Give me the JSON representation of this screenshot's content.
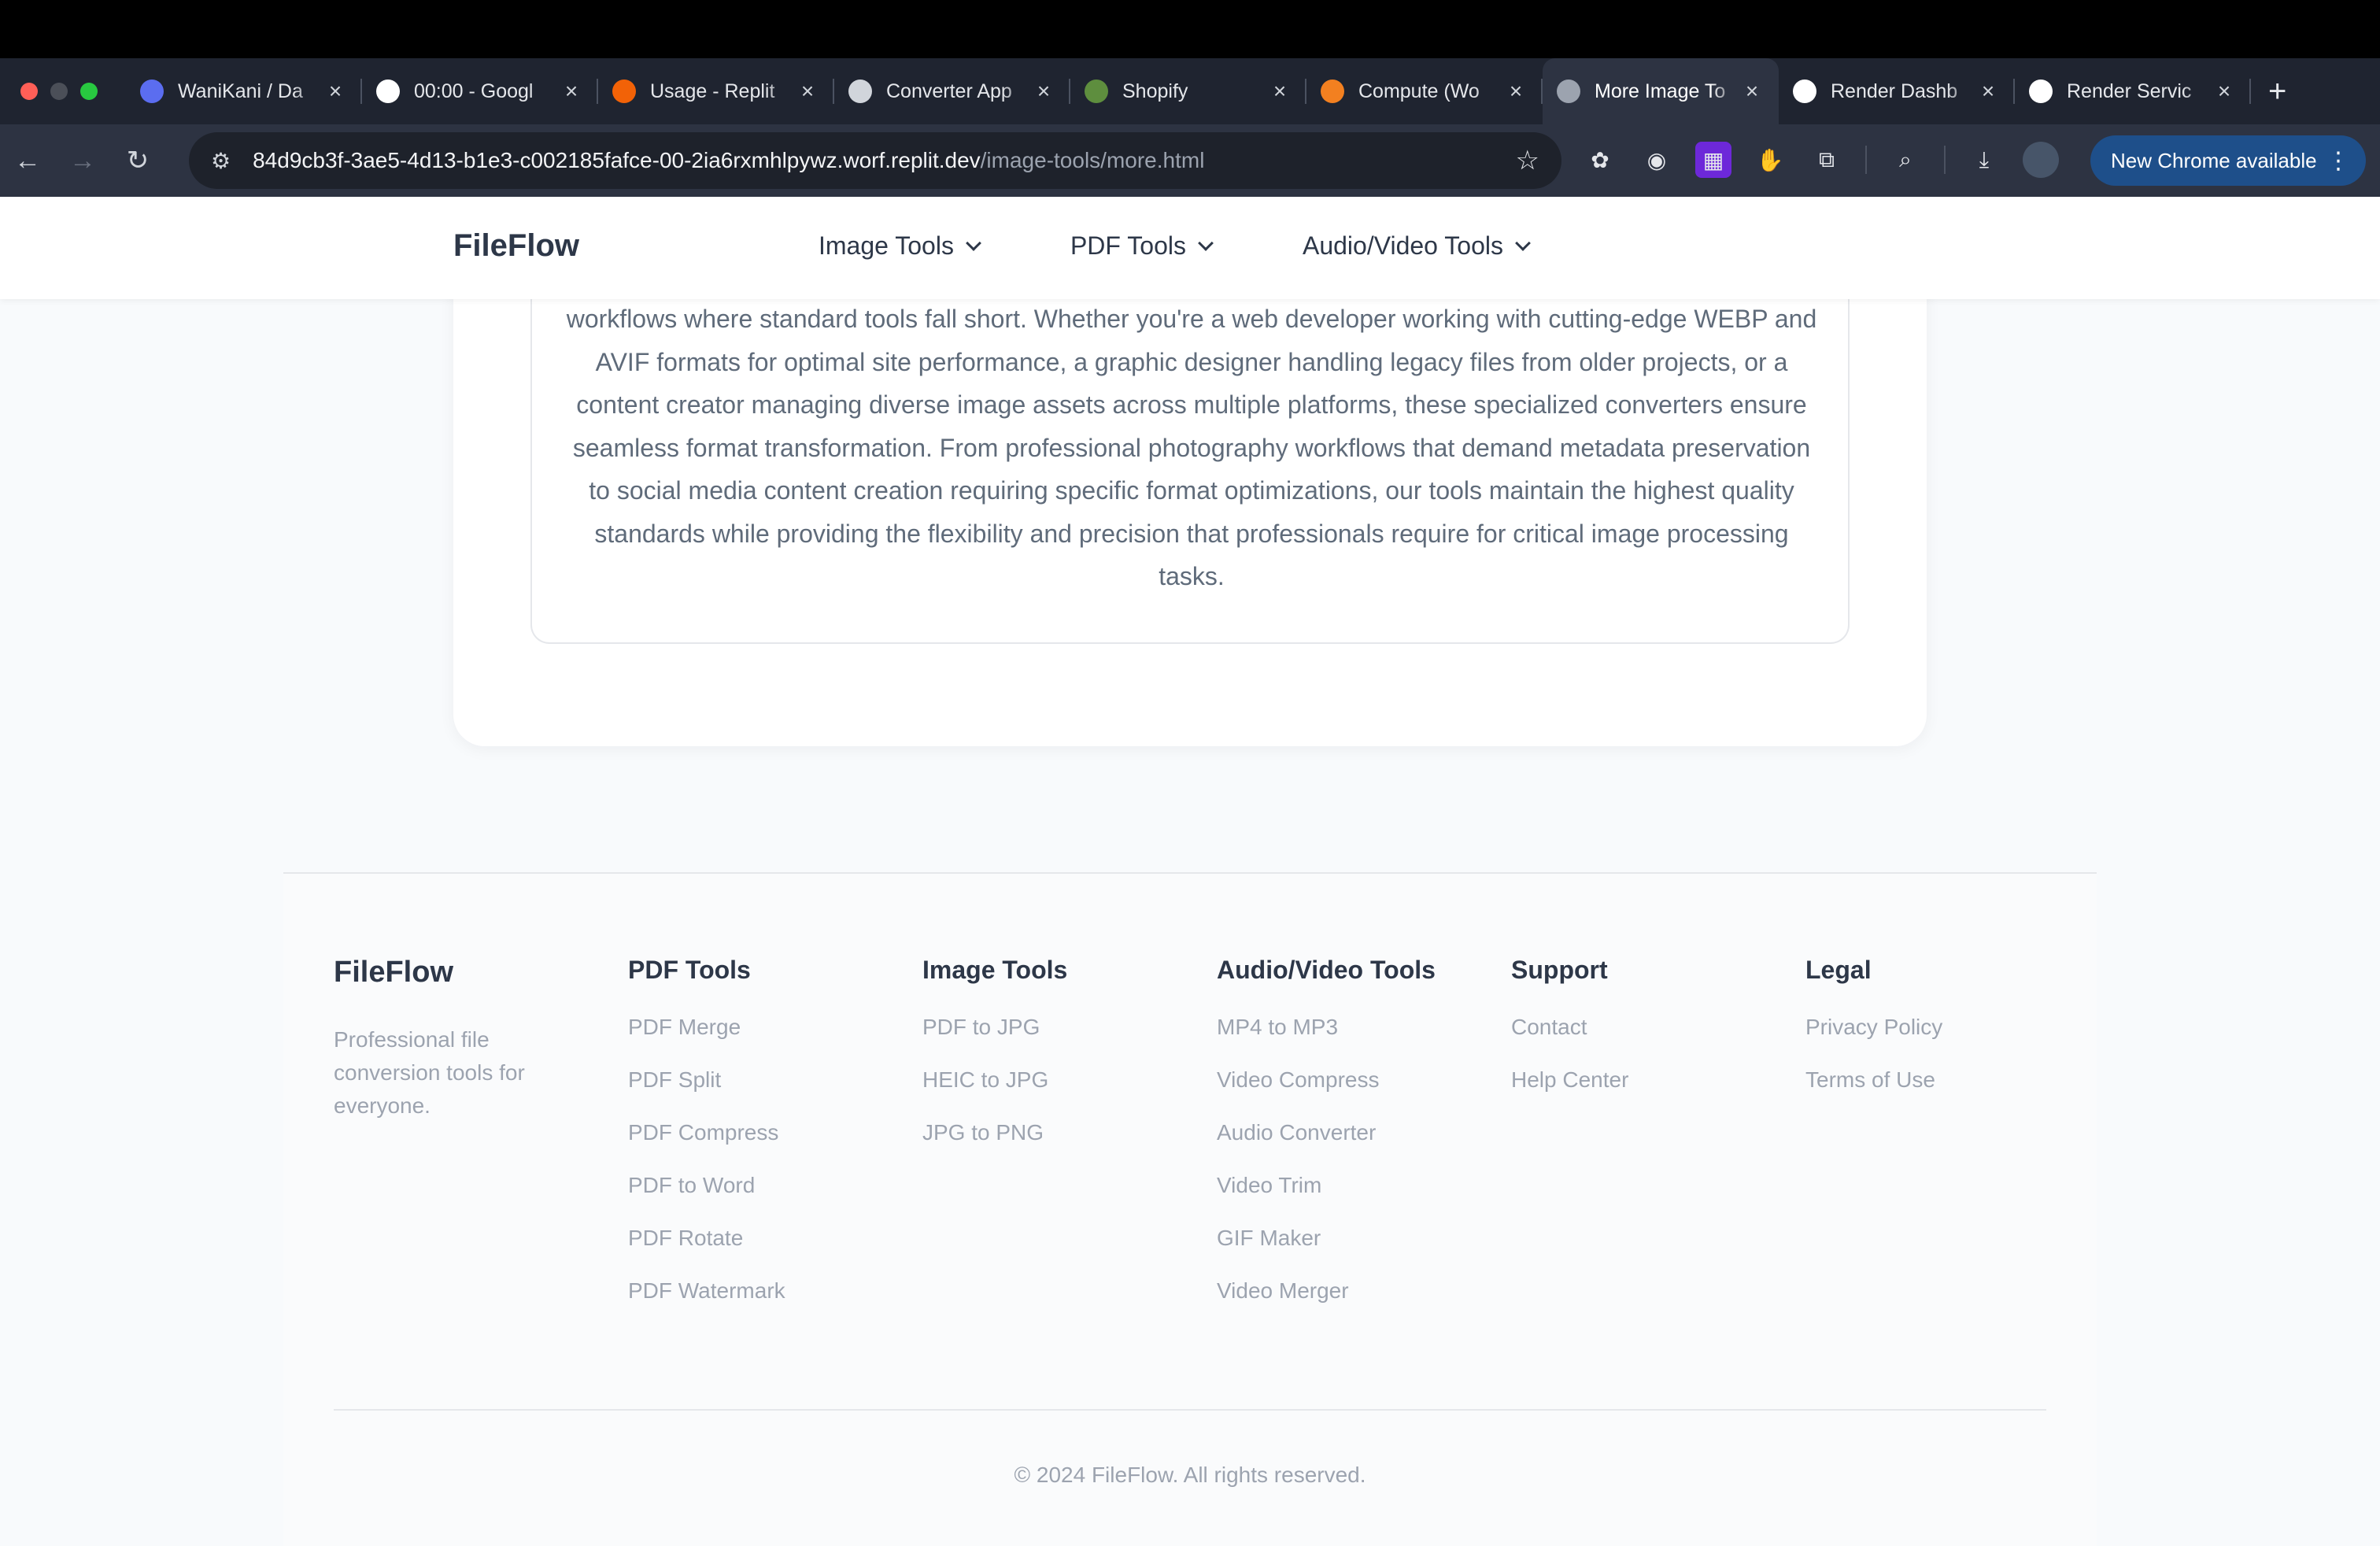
{
  "browser": {
    "tabs": [
      {
        "title": "WaniKani / Da",
        "favicon": "wanikani-icon",
        "color": "#5b6df0",
        "active": false
      },
      {
        "title": "00:00 - Googl",
        "favicon": "google-icon",
        "color": "#ffffff",
        "active": false
      },
      {
        "title": "Usage - Replit",
        "favicon": "replit-icon",
        "color": "#f26207",
        "active": false
      },
      {
        "title": "Converter App",
        "favicon": "openai-icon",
        "color": "#d1d5db",
        "active": false
      },
      {
        "title": "Shopify",
        "favicon": "shopify-icon",
        "color": "#5e8e3e",
        "active": false
      },
      {
        "title": "Compute (Wo",
        "favicon": "cloudflare-icon",
        "color": "#f38020",
        "active": false
      },
      {
        "title": "More Image To",
        "favicon": "globe-icon",
        "color": "#9ca3af",
        "active": true
      },
      {
        "title": "Render Dashb",
        "favicon": "render-icon",
        "color": "#ffffff",
        "active": false
      },
      {
        "title": "Render Servic",
        "favicon": "render-icon",
        "color": "#ffffff",
        "active": false
      }
    ],
    "url_host": "84d9cb3f-3ae5-4d13-b1e3-c002185fafce-00-2ia6rxmhlpywz.worf.replit.dev",
    "url_path": "/image-tools/more.html",
    "update_label": "New Chrome available"
  },
  "site": {
    "brand": "FileFlow",
    "menu": [
      "Image Tools",
      "PDF Tools",
      "Audio/Video Tools"
    ]
  },
  "content": {
    "paragraph": "workflows where standard tools fall short. Whether you're a web developer working with cutting-edge WEBP and AVIF formats for optimal site performance, a graphic designer handling legacy files from older projects, or a content creator managing diverse image assets across multiple platforms, these specialized converters ensure seamless format transformation. From professional photography workflows that demand metadata preservation to social media content creation requiring specific format optimizations, our tools maintain the highest quality standards while providing the flexibility and precision that professionals require for critical image processing tasks."
  },
  "footer": {
    "brand": "FileFlow",
    "description": "Professional file conversion tools for everyone.",
    "columns": [
      {
        "heading": "PDF Tools",
        "links": [
          "PDF Merge",
          "PDF Split",
          "PDF Compress",
          "PDF to Word",
          "PDF Rotate",
          "PDF Watermark"
        ]
      },
      {
        "heading": "Image Tools",
        "links": [
          "PDF to JPG",
          "HEIC to JPG",
          "JPG to PNG"
        ]
      },
      {
        "heading": "Audio/Video Tools",
        "links": [
          "MP4 to MP3",
          "Video Compress",
          "Audio Converter",
          "Video Trim",
          "GIF Maker",
          "Video Merger"
        ]
      },
      {
        "heading": "Support",
        "links": [
          "Contact",
          "Help Center"
        ]
      },
      {
        "heading": "Legal",
        "links": [
          "Privacy Policy",
          "Terms of Use"
        ]
      }
    ],
    "copyright": "© 2024 FileFlow. All rights reserved."
  }
}
